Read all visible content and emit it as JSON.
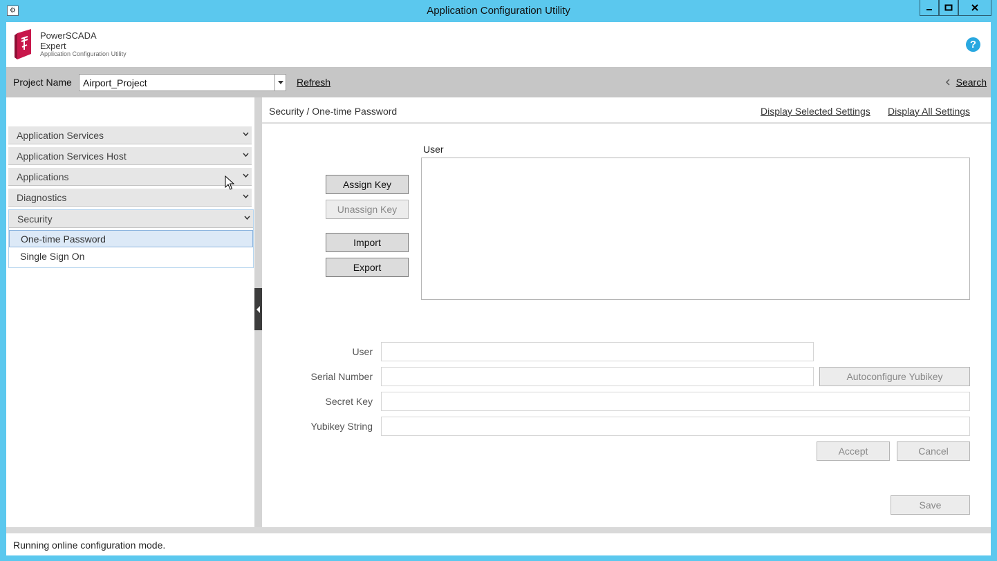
{
  "window": {
    "title": "Application Configuration Utility",
    "system_icon": "gear-icon",
    "controls": [
      "minimize-icon",
      "maximize-icon",
      "close-icon"
    ]
  },
  "header": {
    "brand_line1": "PowerSCADA",
    "brand_line2": "Expert",
    "brand_line3": "Application Configuration Utility",
    "help_glyph": "?",
    "accent_color": "#29a8e0",
    "logo_color": "#c8174b"
  },
  "project_bar": {
    "label": "Project Name",
    "selected_project": "Airport_Project",
    "refresh_label": "Refresh",
    "search_label": "Search"
  },
  "sidebar": {
    "items": [
      {
        "label": "Application Services"
      },
      {
        "label": "Application Services Host"
      },
      {
        "label": "Applications"
      },
      {
        "label": "Diagnostics"
      }
    ],
    "security": {
      "label": "Security",
      "children": [
        {
          "label": "One-time Password",
          "selected": true
        },
        {
          "label": "Single Sign On",
          "selected": false
        }
      ]
    }
  },
  "main": {
    "breadcrumb": "Security / One-time Password",
    "display_selected": "Display Selected Settings",
    "display_all": "Display All Settings",
    "user_list_label": "User",
    "buttons": {
      "assign_key": "Assign Key",
      "unassign_key": "Unassign Key",
      "import": "Import",
      "export": "Export",
      "autoconfigure": "Autoconfigure Yubikey",
      "accept": "Accept",
      "cancel": "Cancel",
      "save": "Save"
    },
    "form": {
      "user_label": "User",
      "serial_label": "Serial Number",
      "secret_label": "Secret Key",
      "yubikey_label": "Yubikey String",
      "user_value": "",
      "serial_value": "",
      "secret_value": "",
      "yubikey_value": ""
    }
  },
  "status": {
    "text": "Running online configuration mode."
  }
}
